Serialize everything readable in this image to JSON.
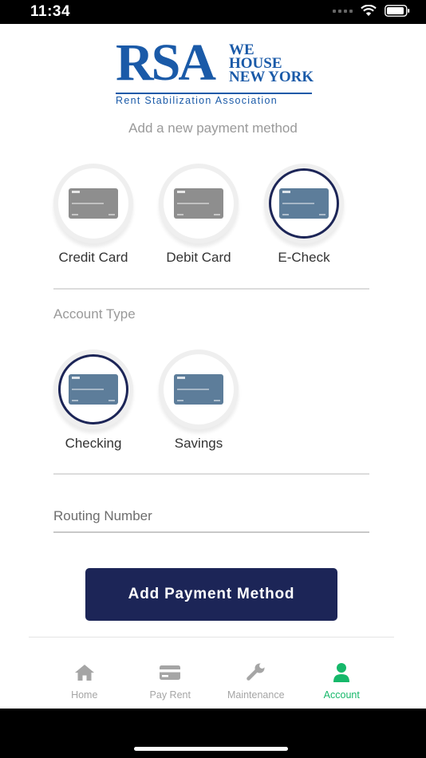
{
  "status_bar": {
    "time": "11:34"
  },
  "logo": {
    "mark": "RSA",
    "words": [
      "WE",
      "HOUSE",
      "NEW YORK"
    ],
    "tagline": "Rent Stabilization Association"
  },
  "subtitle": "Add a new payment method",
  "payment_methods": [
    {
      "label": "Credit Card",
      "card_header": "Card",
      "selected": false
    },
    {
      "label": "Debit Card",
      "card_header": "Card",
      "selected": false
    },
    {
      "label": "E-Check",
      "card_header": "Check",
      "selected": true
    }
  ],
  "account_type": {
    "title": "Account Type",
    "options": [
      {
        "label": "Checking",
        "selected": true
      },
      {
        "label": "Savings",
        "selected": false
      }
    ]
  },
  "routing": {
    "placeholder": "Routing Number",
    "value": ""
  },
  "add_button": {
    "label": "Add Payment Method"
  },
  "tabbar": {
    "tabs": [
      {
        "label": "Home",
        "icon": "home-icon",
        "active": false
      },
      {
        "label": "Pay Rent",
        "icon": "card-icon",
        "active": false
      },
      {
        "label": "Maintenance",
        "icon": "wrench-icon",
        "active": false
      },
      {
        "label": "Account",
        "icon": "user-icon",
        "active": true
      }
    ]
  },
  "colors": {
    "brand_blue": "#1a5aa8",
    "navy": "#1c2557",
    "active_green": "#16b86a",
    "inactive_gray": "#a5a5a5"
  }
}
